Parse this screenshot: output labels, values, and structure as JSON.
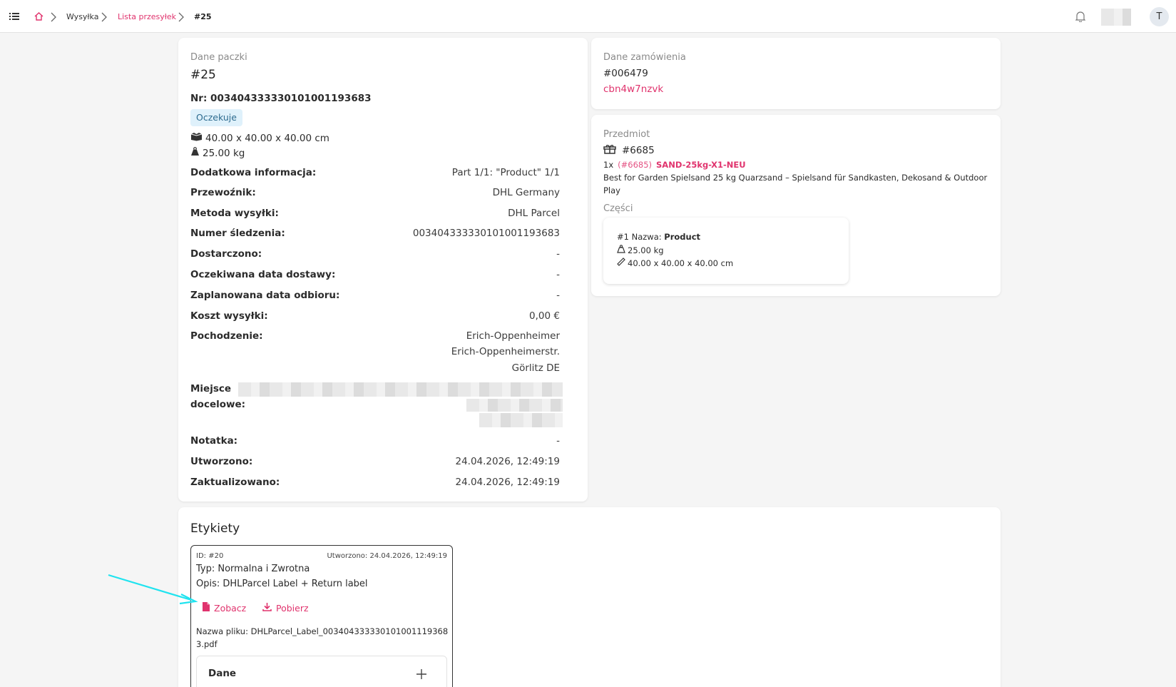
{
  "breadcrumb": {
    "items": [
      "Wysyłka",
      "Lista przesyłek",
      "#25"
    ]
  },
  "user": {
    "avatar_letter": "T"
  },
  "package": {
    "section_label": "Dane paczki",
    "id": "#25",
    "number": "Nr: 003404333330101001193683",
    "status": "Oczekuje",
    "dimensions": "40.00 x 40.00 x 40.00 cm",
    "weight": "25.00 kg",
    "rows": [
      {
        "label": "Dodatkowa informacja:",
        "value": "Part 1/1: \"Product\" 1/1"
      },
      {
        "label": "Przewoźnik:",
        "value": "DHL Germany"
      },
      {
        "label": "Metoda wysyłki:",
        "value": "DHL Parcel"
      },
      {
        "label": "Numer śledzenia:",
        "value": "003404333330101001193683"
      },
      {
        "label": "Dostarczono:",
        "value": "-"
      },
      {
        "label": "Oczekiwana data dostawy:",
        "value": "-"
      },
      {
        "label": "Zaplanowana data odbioru:",
        "value": "-"
      },
      {
        "label": "Koszt wysyłki:",
        "value": "0,00 €"
      }
    ],
    "origin_label": "Pochodzenie:",
    "origin_lines": [
      "Erich-Oppenheimer",
      "Erich-Oppenheimerstr.",
      "Görlitz DE"
    ],
    "destination_label_1": "Miejsce",
    "destination_label_2": "docelowe:",
    "rows2": [
      {
        "label": "Notatka:",
        "value": "-"
      },
      {
        "label": "Utworzono:",
        "value": "24.04.2026, 12:49:19"
      },
      {
        "label": "Zaktualizowano:",
        "value": "24.04.2026, 12:49:19"
      }
    ]
  },
  "order": {
    "section_label": "Dane zamówienia",
    "number": "#006479",
    "code": "cbn4w7nzvk"
  },
  "item": {
    "section_label": "Przedmiot",
    "id": "#6685",
    "qty": "1x",
    "ref": "(#6685)",
    "sku": "SAND-25kg-X1-NEU",
    "description_1": "Best for Garden Spielsand 25 kg Quarzsand – Spielsand für Sandkasten, Dekosand & Outdoor",
    "description_2": "Play",
    "parts_label": "Części",
    "part": {
      "name_prefix": "#1 Nazwa:",
      "name": "Product",
      "weight": "25.00 kg",
      "dimensions": "40.00 x 40.00 x 40.00 cm"
    }
  },
  "labels": {
    "title": "Etykiety",
    "card": {
      "id": "ID: #20",
      "created": "Utworzono: 24.04.2026, 12:49:19",
      "type": "Typ: Normalna i Zwrotna",
      "description": "Opis: DHLParcel Label + Return label",
      "view_label": "Zobacz",
      "download_label": "Pobierz",
      "filename_1": "Nazwa pliku: DHLParcel_Label_00340433333010100111936​8",
      "filename_2": "3.pdf",
      "data_section": "Dane"
    }
  },
  "colors": {
    "accent": "#e0336d",
    "badge_bg": "#dff1fb",
    "annotation_arrow": "#1fe3ef"
  }
}
